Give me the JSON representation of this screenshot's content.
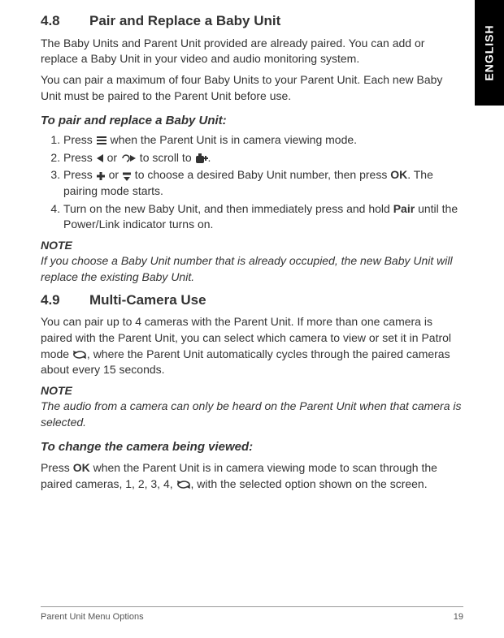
{
  "sideTab": "ENGLISH",
  "sec48": {
    "num": "4.8",
    "title": "Pair and Replace a Baby Unit",
    "p1": " The Baby Units and Parent Unit provided are already paired. You can add or replace a Baby Unit in your video and audio monitoring system.",
    "p2": "You can pair a maximum of four Baby Units to your Parent Unit. Each new Baby Unit must be paired to the Parent Unit before use.",
    "subheading": "To pair and replace a Baby Unit:",
    "steps": {
      "s1a": "Press ",
      "s1b": " when the Parent Unit is in camera viewing mode.",
      "s2a": "Press ",
      "s2b": " or  ",
      "s2c": "  to scroll to ",
      "s2d": ".",
      "s3a": "Press  ",
      "s3b": "  or  ",
      "s3c": "  to choose a desired Baby Unit number, then press ",
      "s3d": ". The pairing mode starts.",
      "s4a": "Turn on the new Baby Unit, and then immediately press and hold ",
      "s4b": "Pair",
      "s4c": " until the Power/Link indicator turns on."
    },
    "noteLabel": "NOTE",
    "noteBody": " If you choose a Baby Unit number that is already occupied, the new Baby Unit will replace the existing Baby Unit."
  },
  "sec49": {
    "num": "4.9",
    "title": "Multi-Camera Use",
    "p1a": "You can pair up to 4 cameras with the Parent Unit. If more than one camera is paired with the Parent Unit, you can select which camera to view or set it in Patrol mode  ",
    "p1b": ", where the Parent Unit automatically cycles through the paired cameras about every 15 seconds.",
    "noteLabel": "NOTE",
    "noteBody": "The audio from a camera can only be heard on the Parent Unit when that camera is selected.",
    "subheading": "To change the camera being viewed:",
    "body2a": "Press ",
    "body2b": " when the Parent Unit is in camera viewing mode to scan through the paired cameras, 1, 2, 3, 4,  ",
    "body2c": ", with the selected option shown on the screen."
  },
  "ok": "OK",
  "footerLeft": "Parent Unit Menu Options",
  "footerRight": "19"
}
